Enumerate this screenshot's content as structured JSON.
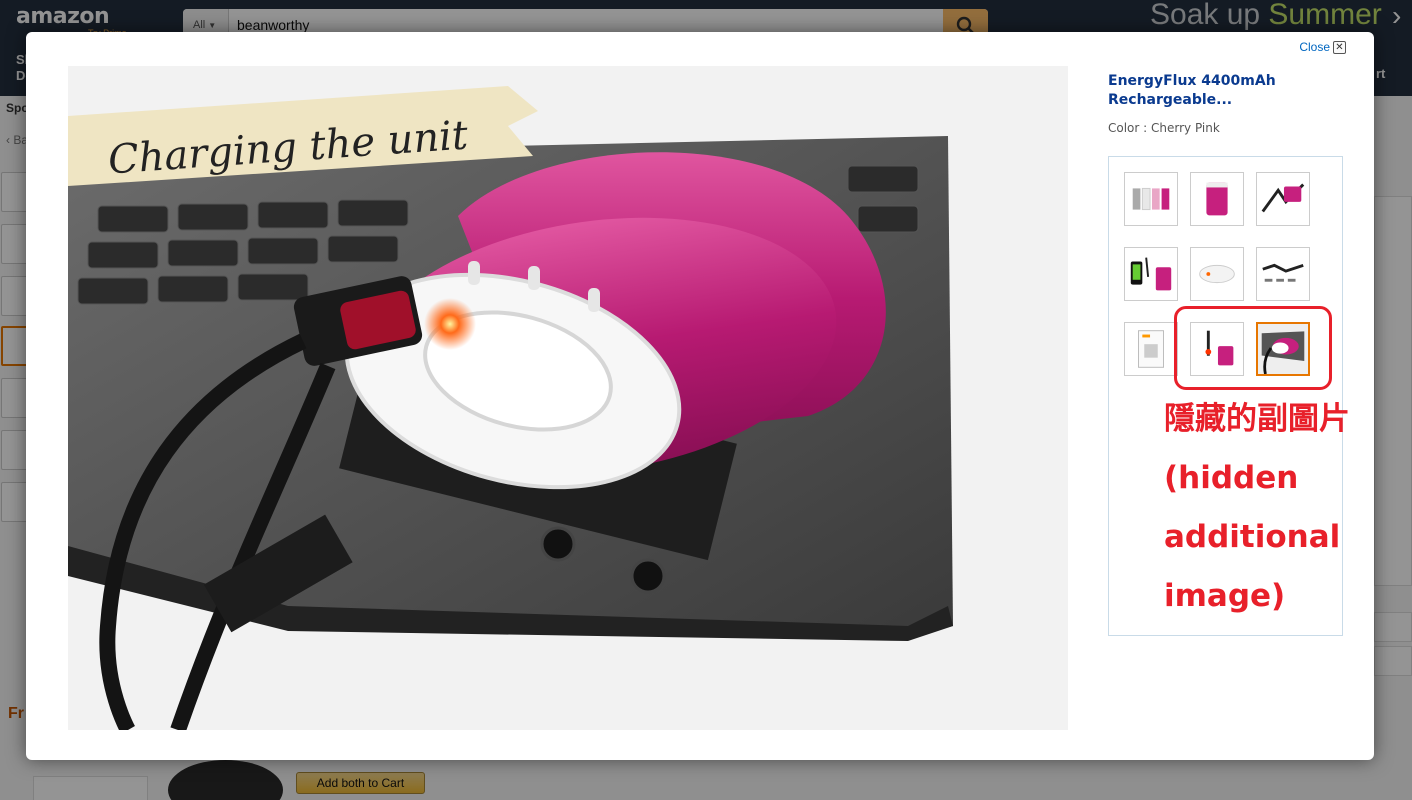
{
  "header": {
    "logo": "amazon",
    "logo_sub": "Try Prime",
    "search": {
      "department": "All",
      "query": "beanworthy"
    },
    "promo": {
      "lead": "Soak up ",
      "accent": "Summer"
    }
  },
  "background_fragments": {
    "nav_left_1": "Sh",
    "nav_left_2": "De",
    "nav_right": "rt",
    "sponsored": "Spo",
    "back": "‹ Ba",
    "frequently_bought": "Fr",
    "add_both_to_cart": "Add both to Cart"
  },
  "modal": {
    "close_label": "Close",
    "product_title": "EnergyFlux 4400mAh Rechargeable...",
    "color_label": "Color : ",
    "color_value": "Cherry Pink",
    "main_image_banner": "Charging the unit",
    "thumbnails": [
      {
        "name": "product-lineup",
        "selected": false
      },
      {
        "name": "pink-unit-front",
        "selected": false
      },
      {
        "name": "accessories-kit",
        "selected": false
      },
      {
        "name": "phone-charging",
        "selected": false
      },
      {
        "name": "white-cap-closeup",
        "selected": false
      },
      {
        "name": "dimensions-strip",
        "selected": false
      },
      {
        "name": "manual-sheet",
        "selected": false
      },
      {
        "name": "hidden-cable-unit",
        "selected": false
      },
      {
        "name": "charging-laptop",
        "selected": true
      }
    ],
    "annotation": {
      "lines": [
        "隱藏的副圖片",
        "(hidden",
        "additional",
        "image)"
      ],
      "color": "#e8202a"
    }
  },
  "colors": {
    "accent": "#e77600",
    "link": "#0066c0",
    "title": "#0a3a8f",
    "product_pink": "#c6207e"
  }
}
